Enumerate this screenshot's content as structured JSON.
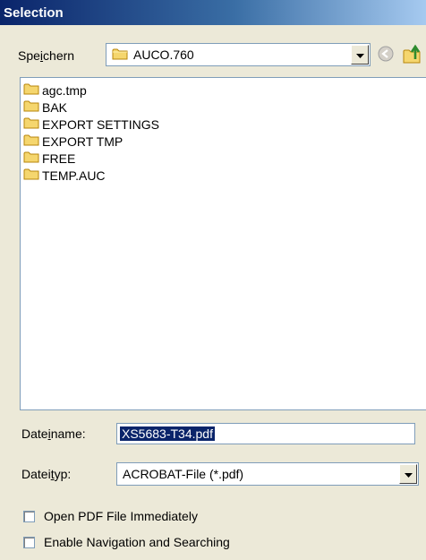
{
  "window": {
    "title": "Selection"
  },
  "save_in": {
    "label_pre": "Spe",
    "label_accel": "i",
    "label_post": "chern",
    "current_folder": "AUCO.760",
    "back_icon": "back-arrow-icon",
    "up_icon": "up-folder-icon"
  },
  "file_list": {
    "items": [
      {
        "name": "agc.tmp",
        "icon": "folder-icon"
      },
      {
        "name": "BAK",
        "icon": "folder-icon"
      },
      {
        "name": "EXPORT SETTINGS",
        "icon": "folder-icon"
      },
      {
        "name": "EXPORT TMP",
        "icon": "folder-icon"
      },
      {
        "name": "FREE",
        "icon": "folder-icon"
      },
      {
        "name": "TEMP.AUC",
        "icon": "folder-icon"
      }
    ]
  },
  "filename": {
    "label_pre": "Date",
    "label_accel": "i",
    "label_post": "name:",
    "value": "XS5683-T34.pdf"
  },
  "filetype": {
    "label_pre": "Datei",
    "label_accel": "t",
    "label_post": "yp:",
    "value": "ACROBAT-File (*.pdf)"
  },
  "options": {
    "open_pdf": {
      "label": "Open PDF File Immediately",
      "checked": false
    },
    "enable_nav": {
      "label": "Enable Navigation and Searching",
      "checked": false
    }
  },
  "colors": {
    "title_bar_start": "#0a246a",
    "dialog_bg": "#ece9d8",
    "selection_bg": "#0a246a",
    "folder_yellow": "#f5d66e"
  }
}
